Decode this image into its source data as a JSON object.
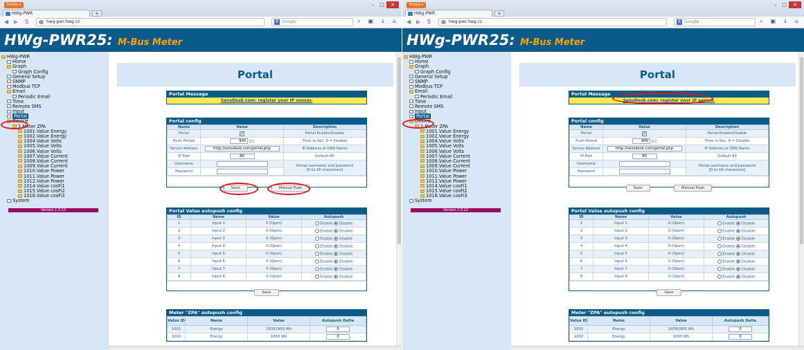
{
  "browser": {
    "app_button": "Firefox ▾",
    "tab_title": "HWg-PWR",
    "new_tab": "+",
    "url": "hwg-pwr.hwg.cz",
    "search_placeholder": "Google",
    "win_min": "–",
    "win_max": "□",
    "win_close": "✕"
  },
  "banner": {
    "title": "HWg-PWR25:",
    "subtitle": "M-Bus Meter"
  },
  "tree": [
    {
      "label": "HWg-PWR",
      "indent": 0,
      "icon": "folder-icon"
    },
    {
      "label": "Home",
      "indent": 1,
      "icon": "page-icon"
    },
    {
      "label": "Graph",
      "indent": 1,
      "icon": "folder-icon"
    },
    {
      "label": "Graph Config",
      "indent": 2,
      "icon": "page-icon"
    },
    {
      "label": "General Setup",
      "indent": 1,
      "icon": "page-icon"
    },
    {
      "label": "SNMP",
      "indent": 1,
      "icon": "page-icon"
    },
    {
      "label": "Modbus TCP",
      "indent": 1,
      "icon": "page-icon"
    },
    {
      "label": "Email",
      "indent": 1,
      "icon": "folder-icon"
    },
    {
      "label": "Periodic Email",
      "indent": 2,
      "icon": "page-icon"
    },
    {
      "label": "Time",
      "indent": 1,
      "icon": "page-icon"
    },
    {
      "label": "Remote SMS",
      "indent": 1,
      "icon": "page-icon"
    },
    {
      "label": "Input",
      "indent": 1,
      "icon": "page-icon"
    },
    {
      "label": "Portal",
      "indent": 1,
      "icon": "page-icon",
      "active": true
    },
    {
      "label": "Device",
      "indent": 1,
      "icon": "folder-icon"
    },
    {
      "label": "1.Meter ZPA",
      "indent": 2,
      "icon": "folder-icon"
    },
    {
      "label": "1001.Value Energy",
      "indent": 3,
      "icon": "folder-icon"
    },
    {
      "label": "1002.Value Energy",
      "indent": 3,
      "icon": "folder-icon"
    },
    {
      "label": "1004.Value Volts",
      "indent": 3,
      "icon": "folder-icon"
    },
    {
      "label": "1005.Value Volts",
      "indent": 3,
      "icon": "folder-icon"
    },
    {
      "label": "1006.Value Volts",
      "indent": 3,
      "icon": "folder-icon"
    },
    {
      "label": "1007.Value Current",
      "indent": 3,
      "icon": "folder-icon"
    },
    {
      "label": "1008.Value Current",
      "indent": 3,
      "icon": "folder-icon"
    },
    {
      "label": "1009.Value Current",
      "indent": 3,
      "icon": "folder-icon"
    },
    {
      "label": "1010.Value Power",
      "indent": 3,
      "icon": "folder-icon"
    },
    {
      "label": "1011.Value Power",
      "indent": 3,
      "icon": "folder-icon"
    },
    {
      "label": "1012.Value Power",
      "indent": 3,
      "icon": "folder-icon"
    },
    {
      "label": "1014.Value cosFi1",
      "indent": 3,
      "icon": "folder-icon"
    },
    {
      "label": "1015.Value cosFi2",
      "indent": 3,
      "icon": "folder-icon"
    },
    {
      "label": "1016.Value cosFi3",
      "indent": 3,
      "icon": "folder-icon"
    },
    {
      "label": "System",
      "indent": 1,
      "icon": "page-icon"
    }
  ],
  "version": "Version 1.0.12",
  "page_title": "Portal",
  "portal_message": {
    "header": "Portal Message",
    "link": "SensDesk.com: register your IP sensor."
  },
  "portal_config": {
    "header": "Portal config",
    "columns": [
      "Name",
      "Value",
      "Description"
    ],
    "portal_label": "Portal",
    "portal_checked": "✔",
    "portal_desc": "Portal Enable/Disable",
    "push_label": "Push Period",
    "push_value": "900",
    "push_unit": "[s]",
    "push_desc": "Time in Sec, 0 = Disable",
    "server_label": "Server Address",
    "server_value": "http://sensdesk.com/portal.php",
    "server_desc": "IP Address or DNS Name",
    "port_label": "IP Port",
    "port_value": "80",
    "port_desc": "Default 80",
    "user_label": "Username",
    "pass_label": "Password",
    "cred_desc1": "Portal username and password",
    "cred_desc2": "[0 to 16 characters]",
    "save": "Save",
    "manual_push": "Manual Push"
  },
  "autopush": {
    "header": "Portal Value autopush config",
    "columns": [
      "ID",
      "Name",
      "Value",
      "Autopush"
    ],
    "rows": [
      {
        "id": "1",
        "name": "Input 1",
        "value": "0 (Open)"
      },
      {
        "id": "2",
        "name": "Input 2",
        "value": "0 (Open)"
      },
      {
        "id": "3",
        "name": "Input 3",
        "value": "0 (Open)"
      },
      {
        "id": "4",
        "name": "Input 4",
        "value": "0 (Open)"
      },
      {
        "id": "5",
        "name": "Input 5",
        "value": "0 (Open)"
      },
      {
        "id": "6",
        "name": "Input 6",
        "value": "0 (Open)"
      },
      {
        "id": "7",
        "name": "Input 7",
        "value": "0 (Open)"
      },
      {
        "id": "8",
        "name": "Input 8",
        "value": "0 (Open)"
      }
    ],
    "enable": "Enable",
    "disable": "Disable",
    "save": "Save"
  },
  "meter": {
    "header": "Meter \"ZPA\" autopush config",
    "columns": [
      "Value ID",
      "Name",
      "Value",
      "Autopush Delta"
    ],
    "rows": [
      {
        "id": "1001",
        "name": "Energy",
        "value": "19391900 Wh",
        "delta": "0"
      },
      {
        "id": "1002",
        "name": "Energy",
        "value": "1000 Wh",
        "delta": "0"
      }
    ]
  },
  "colors": {
    "brand": "#0b5b8a",
    "accent": "#ffa200",
    "annotation": "#e01818",
    "version_bar": "#9c0c64"
  }
}
